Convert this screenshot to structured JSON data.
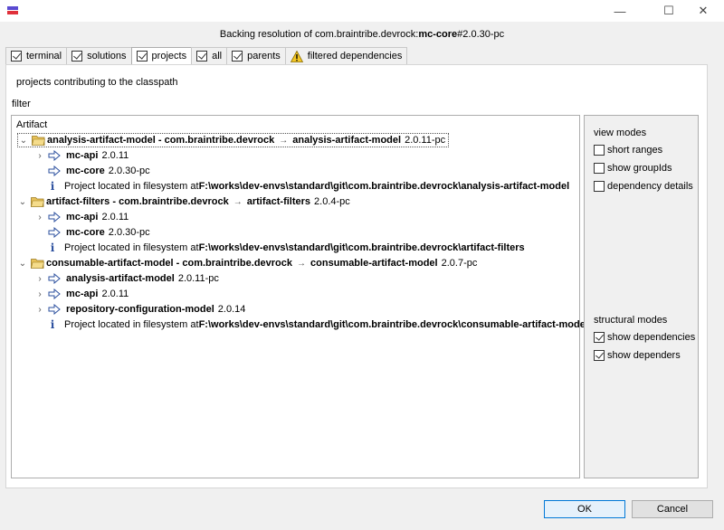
{
  "window": {
    "dialog_title_prefix": "Backing resolution of com.braintribe.devrock:",
    "dialog_title_artifact": "mc-core",
    "dialog_title_version": "#2.0.30-pc",
    "min_glyph": "—",
    "max_glyph": "☐",
    "close_glyph": "✕"
  },
  "tabs": [
    {
      "label": "terminal",
      "checked": true
    },
    {
      "label": "solutions",
      "checked": true
    },
    {
      "label": "projects",
      "checked": true
    },
    {
      "label": "all",
      "checked": true
    },
    {
      "label": "parents",
      "checked": true
    },
    {
      "label": "filtered dependencies",
      "warning": true
    }
  ],
  "panel": {
    "heading": "projects contributing to the classpath",
    "filter_label": "filter",
    "filter_value": "",
    "column_header": "Artifact"
  },
  "tree": [
    {
      "type": "project",
      "name": "analysis-artifact-model - com.braintribe.devrock",
      "sep": "→",
      "artifact": "analysis-artifact-model",
      "version": "2.0.11-pc",
      "toggle": "⌄"
    },
    {
      "type": "dep",
      "name": "mc-api",
      "version": "2.0.11",
      "toggle": "›"
    },
    {
      "type": "dep",
      "name": "mc-core",
      "version": "2.0.30-pc",
      "toggle": ""
    },
    {
      "type": "info",
      "prefix": "Project located in filesystem at ",
      "path": "F:\\works\\dev-envs\\standard\\git\\com.braintribe.devrock\\analysis-artifact-model",
      "icon": "i"
    },
    {
      "type": "project",
      "name": "artifact-filters - com.braintribe.devrock",
      "sep": "→",
      "artifact": "artifact-filters",
      "version": "2.0.4-pc",
      "toggle": "⌄"
    },
    {
      "type": "dep",
      "name": "mc-api",
      "version": "2.0.11",
      "toggle": "›"
    },
    {
      "type": "dep",
      "name": "mc-core",
      "version": "2.0.30-pc",
      "toggle": ""
    },
    {
      "type": "info",
      "prefix": "Project located in filesystem at ",
      "path": "F:\\works\\dev-envs\\standard\\git\\com.braintribe.devrock\\artifact-filters",
      "icon": "i"
    },
    {
      "type": "project",
      "name": "consumable-artifact-model - com.braintribe.devrock",
      "sep": "→",
      "artifact": "consumable-artifact-model",
      "version": "2.0.7-pc",
      "toggle": "⌄"
    },
    {
      "type": "dep",
      "name": "analysis-artifact-model",
      "version": "2.0.11-pc",
      "toggle": "›"
    },
    {
      "type": "dep",
      "name": "mc-api",
      "version": "2.0.11",
      "toggle": "›"
    },
    {
      "type": "dep",
      "name": "repository-configuration-model",
      "version": "2.0.14",
      "toggle": "›"
    },
    {
      "type": "info",
      "prefix": "Project located in filesystem at ",
      "path": "F:\\works\\dev-envs\\standard\\git\\com.braintribe.devrock\\consumable-artifact-model",
      "icon": "i"
    }
  ],
  "view_modes": {
    "title": "view modes",
    "options": [
      {
        "label": "short ranges",
        "checked": false
      },
      {
        "label": "show groupIds",
        "checked": false
      },
      {
        "label": "dependency details",
        "checked": false
      }
    ]
  },
  "structural_modes": {
    "title": "structural modes",
    "options": [
      {
        "label": "show dependencies",
        "checked": true
      },
      {
        "label": "show dependers",
        "checked": true
      }
    ]
  },
  "buttons": {
    "ok": "OK",
    "cancel": "Cancel"
  },
  "colors": {
    "accent": "#0078d7",
    "folder": "#e8c25a",
    "arrow": "#2b4f9e",
    "info": "#2b4f9e",
    "warning": "#f3c623"
  }
}
